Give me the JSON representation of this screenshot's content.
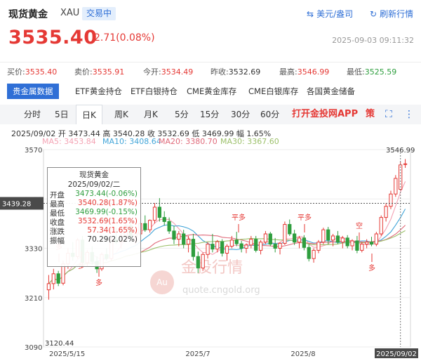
{
  "header": {
    "title": "现货黄金",
    "symbol": "XAU",
    "status": "交易中",
    "currency_link": "美元/盎司",
    "refresh_link": "刷新行情",
    "price": "3535.40",
    "change": "2.71(0.08%)",
    "datetime": "2025-09-03 09:11:32"
  },
  "stats": {
    "buy_label": "买价:",
    "buy_value": "3535.40",
    "sell_label": "卖价:",
    "sell_value": "3535.91",
    "open_label": "今开:",
    "open_value": "3534.49",
    "prev_label": "昨收:",
    "prev_value": "3532.69",
    "high_label": "最高:",
    "high_value": "3546.99",
    "low_label": "最低:",
    "low_value": "3525.59"
  },
  "category_tabs": [
    "贵金属数据",
    "ETF黄金持仓",
    "ETF白银持仓",
    "CME黄金库存",
    "CME白银库存",
    "各国黄金储备"
  ],
  "period_tabs": [
    "分时",
    "5日",
    "日K",
    "周K",
    "月K",
    "5分",
    "15分",
    "30分",
    "60分"
  ],
  "active_period": "日K",
  "promo": "打开金投网APP",
  "kline_icons": {
    "strategy": "策",
    "fullscreen": "⛶",
    "more": "⋮"
  },
  "ohlc_line": "2025/09/02  开 3473.44  高 3540.28  收 3532.69  低 3469.99  幅 1.65%",
  "ma_legend": [
    {
      "label": "MA5: 3453.84",
      "color": "#f4a3b4"
    },
    {
      "label": "MA10: 3408.64",
      "color": "#42a5d8"
    },
    {
      "label": "MA20: 3380.70",
      "color": "#e06a7a"
    },
    {
      "label": "MA30: 3367.60",
      "color": "#9cc06a"
    }
  ],
  "watermark": {
    "text": "金投行情",
    "url": "quote.cngold.org",
    "logo": "Au"
  },
  "tooltip": {
    "title": "现货黄金",
    "date": "2025/09/02/二",
    "rows": [
      {
        "k": "开盘",
        "v": "3473.44(-0.06%)",
        "c": "#2e9e3e"
      },
      {
        "k": "最高",
        "v": "3540.28(1.87%)",
        "c": "#e53935"
      },
      {
        "k": "最低",
        "v": "3469.99(-0.15%)",
        "c": "#2e9e3e"
      },
      {
        "k": "收盘",
        "v": "3532.69(1.65%)",
        "c": "#e53935"
      },
      {
        "k": "涨跌",
        "v": "57.34(1.65%)",
        "c": "#e53935"
      },
      {
        "k": "振幅",
        "v": "70.29(2.02%)",
        "c": "#333333"
      }
    ]
  },
  "chart_data": {
    "type": "candlestick",
    "y_ticks": [
      "3570",
      "3450",
      "3330",
      "3210",
      "3090"
    ],
    "ylim": [
      3090,
      3570
    ],
    "x_labels": [
      "2025/5/15",
      "2025/7",
      "2025/8",
      "2025/09/02"
    ],
    "crosshair_price": "3439.28",
    "high_label": "3546.99",
    "low_label": "3120.44",
    "signals": [
      "多",
      "多",
      "多",
      "平多",
      "平多",
      "空",
      "多"
    ],
    "colors": {
      "up": "#e53935",
      "down": "#2e9e3e"
    },
    "candles": [
      [
        3229,
        3265,
        3205,
        3244
      ],
      [
        3244,
        3280,
        3230,
        3268
      ],
      [
        3268,
        3275,
        3238,
        3245
      ],
      [
        3245,
        3300,
        3240,
        3292
      ],
      [
        3292,
        3330,
        3280,
        3318
      ],
      [
        3318,
        3345,
        3300,
        3310
      ],
      [
        3310,
        3355,
        3305,
        3350
      ],
      [
        3350,
        3360,
        3285,
        3295
      ],
      [
        3295,
        3325,
        3285,
        3320
      ],
      [
        3320,
        3335,
        3290,
        3298
      ],
      [
        3298,
        3310,
        3270,
        3280
      ],
      [
        3280,
        3320,
        3275,
        3315
      ],
      [
        3315,
        3330,
        3300,
        3305
      ],
      [
        3305,
        3360,
        3300,
        3352
      ],
      [
        3352,
        3380,
        3340,
        3345
      ],
      [
        3345,
        3370,
        3330,
        3360
      ],
      [
        3360,
        3395,
        3355,
        3385
      ],
      [
        3385,
        3400,
        3350,
        3358
      ],
      [
        3358,
        3375,
        3340,
        3365
      ],
      [
        3365,
        3395,
        3360,
        3390
      ],
      [
        3390,
        3410,
        3370,
        3375
      ],
      [
        3375,
        3400,
        3368,
        3398
      ],
      [
        3398,
        3440,
        3390,
        3430
      ],
      [
        3430,
        3452,
        3395,
        3405
      ],
      [
        3405,
        3420,
        3385,
        3395
      ],
      [
        3395,
        3405,
        3365,
        3372
      ],
      [
        3372,
        3385,
        3340,
        3352
      ],
      [
        3352,
        3372,
        3335,
        3365
      ],
      [
        3365,
        3375,
        3330,
        3340
      ],
      [
        3340,
        3360,
        3320,
        3352
      ],
      [
        3352,
        3365,
        3300,
        3310
      ],
      [
        3310,
        3322,
        3270,
        3282
      ],
      [
        3282,
        3320,
        3275,
        3315
      ],
      [
        3315,
        3345,
        3305,
        3340
      ],
      [
        3340,
        3365,
        3320,
        3328
      ],
      [
        3328,
        3350,
        3320,
        3346
      ],
      [
        3346,
        3352,
        3310,
        3318
      ],
      [
        3318,
        3340,
        3300,
        3335
      ],
      [
        3335,
        3360,
        3330,
        3350
      ],
      [
        3350,
        3370,
        3335,
        3341
      ],
      [
        3341,
        3348,
        3320,
        3330
      ],
      [
        3330,
        3342,
        3318,
        3338
      ],
      [
        3338,
        3360,
        3330,
        3352
      ],
      [
        3352,
        3360,
        3320,
        3325
      ],
      [
        3325,
        3350,
        3315,
        3345
      ],
      [
        3345,
        3372,
        3340,
        3365
      ],
      [
        3365,
        3370,
        3335,
        3340
      ],
      [
        3340,
        3355,
        3320,
        3330
      ],
      [
        3330,
        3345,
        3315,
        3342
      ],
      [
        3342,
        3395,
        3338,
        3388
      ],
      [
        3388,
        3400,
        3360,
        3365
      ],
      [
        3365,
        3375,
        3338,
        3345
      ],
      [
        3345,
        3360,
        3330,
        3355
      ],
      [
        3355,
        3362,
        3325,
        3332
      ],
      [
        3332,
        3340,
        3298,
        3305
      ],
      [
        3305,
        3330,
        3295,
        3325
      ],
      [
        3325,
        3350,
        3318,
        3345
      ],
      [
        3345,
        3380,
        3340,
        3375
      ],
      [
        3375,
        3382,
        3340,
        3350
      ],
      [
        3350,
        3365,
        3335,
        3360
      ],
      [
        3360,
        3372,
        3340,
        3345
      ],
      [
        3345,
        3360,
        3330,
        3355
      ],
      [
        3355,
        3362,
        3330,
        3336
      ],
      [
        3336,
        3352,
        3325,
        3348
      ],
      [
        3348,
        3360,
        3318,
        3325
      ],
      [
        3325,
        3345,
        3320,
        3340
      ],
      [
        3340,
        3352,
        3330,
        3345
      ],
      [
        3345,
        3358,
        3335,
        3340
      ],
      [
        3340,
        3370,
        3335,
        3365
      ],
      [
        3365,
        3410,
        3360,
        3405
      ],
      [
        3405,
        3440,
        3395,
        3432
      ],
      [
        3432,
        3470,
        3425,
        3462
      ],
      [
        3462,
        3508,
        3455,
        3500
      ],
      [
        3473.44,
        3540.28,
        3469.99,
        3532.69
      ],
      [
        3534.49,
        3546.99,
        3525.59,
        3535.4
      ]
    ]
  }
}
